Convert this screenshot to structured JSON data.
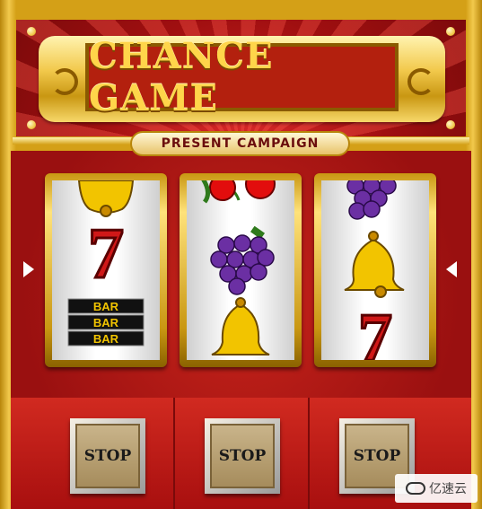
{
  "title": "CHANCE GAME",
  "subtitle": "PRESENT CAMPAIGN",
  "reels": [
    {
      "symbols": [
        "bell-icon",
        "seven-icon",
        "bar-icon"
      ]
    },
    {
      "symbols": [
        "cherry-icon",
        "grape-icon",
        "bell-icon"
      ]
    },
    {
      "symbols": [
        "grape-icon",
        "bell-icon",
        "seven-icon"
      ]
    }
  ],
  "bar_text": "BAR",
  "seven_text": "7",
  "stop_buttons": [
    "STOP",
    "STOP",
    "STOP"
  ],
  "watermark": "亿速云",
  "colors": {
    "gold": "#d4a017",
    "red": "#b3200e",
    "seven": "#d01818",
    "grape": "#6b2fa3",
    "bell": "#f2c400"
  }
}
